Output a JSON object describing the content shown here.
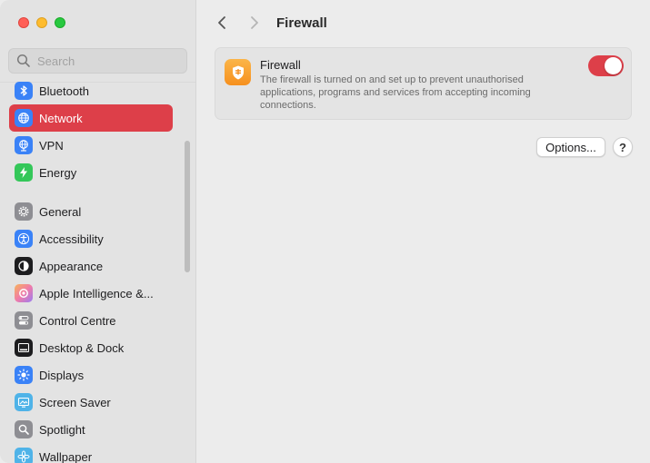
{
  "window": {
    "title": "Firewall"
  },
  "search": {
    "placeholder": "Search"
  },
  "sidebar": {
    "items": [
      {
        "label": "Bluetooth",
        "icon": "bluetooth-icon",
        "color": "#3a82f7"
      },
      {
        "label": "Network",
        "icon": "globe-icon",
        "color": "#3a82f7",
        "active": true
      },
      {
        "label": "VPN",
        "icon": "vpn-globe-icon",
        "color": "#3a82f7"
      },
      {
        "label": "Energy",
        "icon": "bolt-icon",
        "color": "#34c759"
      },
      {
        "label": "General",
        "icon": "gear-icon",
        "color": "#8e8e93"
      },
      {
        "label": "Accessibility",
        "icon": "accessibility-icon",
        "color": "#3a82f7"
      },
      {
        "label": "Appearance",
        "icon": "appearance-icon",
        "color": "#1d1d1f"
      },
      {
        "label": "Apple Intelligence &...",
        "icon": "apple-intelligence-icon",
        "color": "#f08aa8"
      },
      {
        "label": "Control Centre",
        "icon": "toggles-icon",
        "color": "#8e8e93"
      },
      {
        "label": "Desktop & Dock",
        "icon": "dock-icon",
        "color": "#1d1d1f"
      },
      {
        "label": "Displays",
        "icon": "sun-icon",
        "color": "#3a82f7"
      },
      {
        "label": "Screen Saver",
        "icon": "screensaver-icon",
        "color": "#4fb3e8"
      },
      {
        "label": "Spotlight",
        "icon": "magnifier-icon",
        "color": "#8e8e93"
      },
      {
        "label": "Wallpaper",
        "icon": "flower-icon",
        "color": "#4fb3e8"
      }
    ]
  },
  "firewall": {
    "title": "Firewall",
    "description": "The firewall is turned on and set up to prevent unauthorised applications, programs and services from accepting incoming connections.",
    "enabled": true
  },
  "buttons": {
    "options": "Options...",
    "help": "?"
  },
  "colors": {
    "accent": "#dd3f49",
    "firewall_icon": "#f6901e"
  }
}
